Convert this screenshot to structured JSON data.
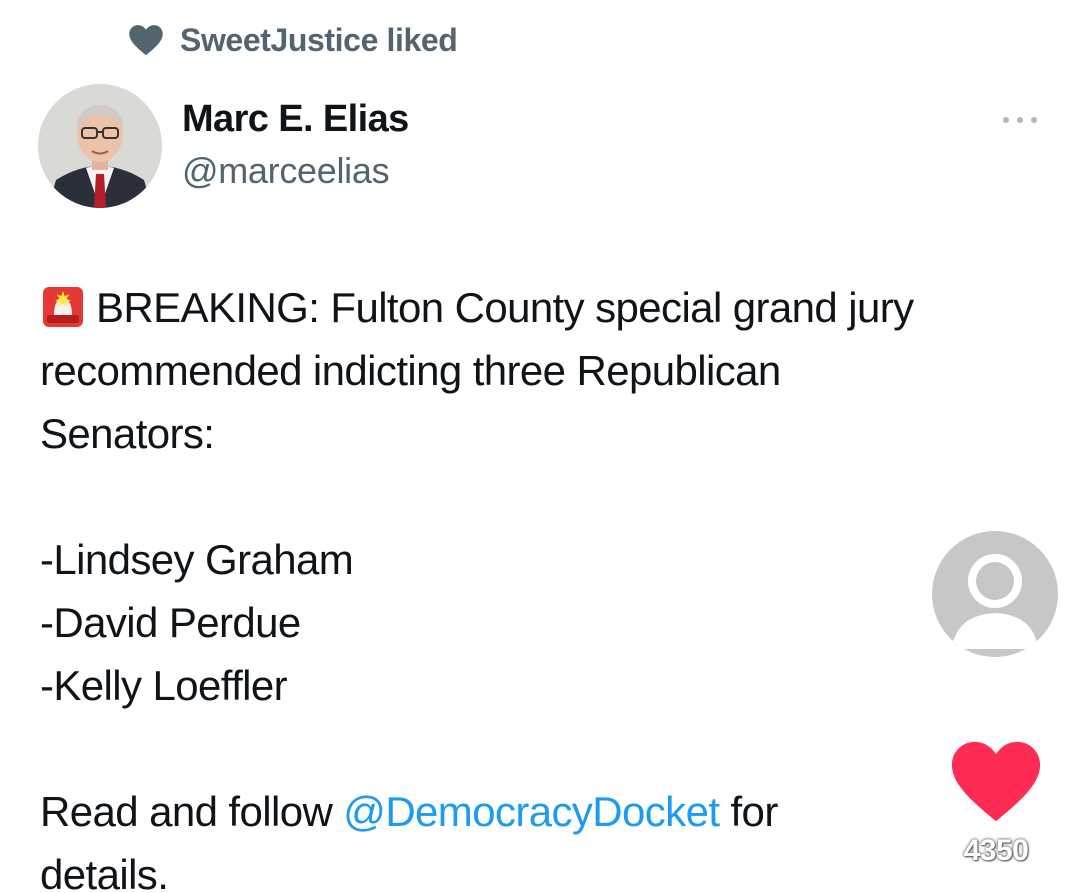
{
  "social_context": {
    "text": "SweetJustice liked",
    "icon": "heart-icon"
  },
  "author": {
    "display_name": "Marc E. Elias",
    "handle": "@marceelias",
    "avatar": "author-avatar-photo"
  },
  "tweet": {
    "emoji": "rotating-light-icon",
    "line1": "BREAKING: Fulton County special grand jury",
    "line2": "recommended indicting three Republican",
    "line3": "Senators:",
    "names": [
      "-Lindsey Graham",
      "-David Perdue",
      "-Kelly Loeffler"
    ],
    "cta_before": "Read and follow ",
    "cta_mention": "@DemocracyDocket",
    "cta_after": " for",
    "cta_line2": "details."
  },
  "overlay": {
    "profile_icon": "default-profile-icon",
    "like_icon": "heart-icon",
    "like_count": "4350"
  },
  "colors": {
    "text_primary": "#0f1419",
    "text_secondary": "#536471",
    "mention": "#1d9bf0",
    "like_red": "#fe2c55"
  }
}
